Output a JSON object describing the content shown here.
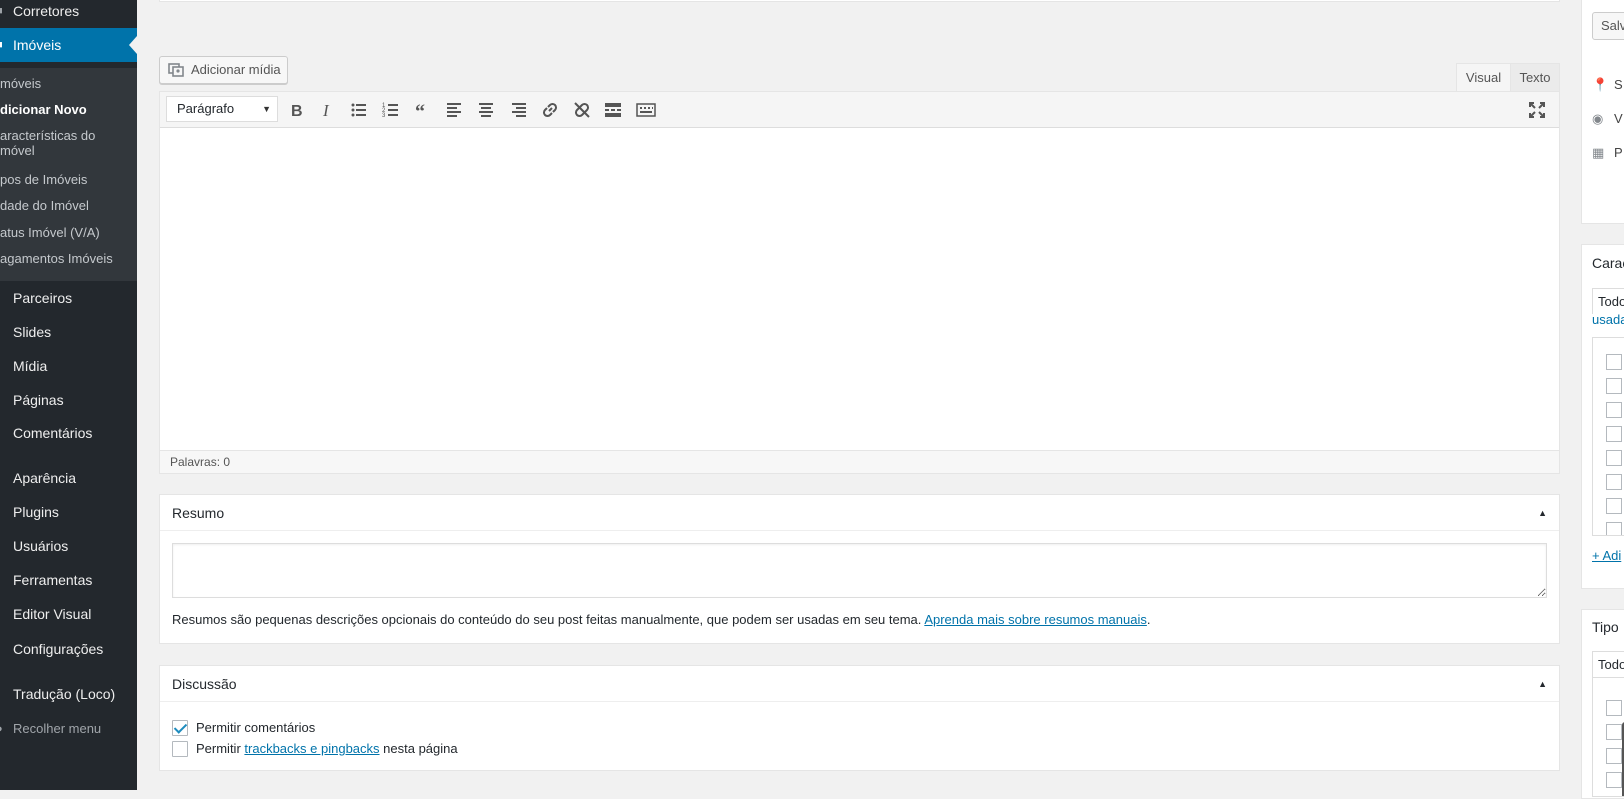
{
  "sidebar": {
    "items_top": [
      {
        "label": "Corretores",
        "icon": "users-icon"
      },
      {
        "label": "Imóveis",
        "icon": "building-icon"
      }
    ],
    "submenu": [
      "móveis",
      "dicionar Novo",
      "aracterísticas do móvel",
      "pos de Imóveis",
      "dade do Imóvel",
      "atus Imóvel (V/A)",
      "agamentos Imóveis"
    ],
    "items_bottom": [
      "Parceiros",
      "Slides",
      "Mídia",
      "Páginas",
      "Comentários",
      "Aparência",
      "Plugins",
      "Usuários",
      "Ferramentas",
      "Editor Visual",
      "Configurações",
      "Tradução (Loco)"
    ],
    "collapse_label": "Recolher menu"
  },
  "editor": {
    "add_media": "Adicionar mídia",
    "tabs": [
      "Visual",
      "Texto"
    ],
    "format_select": "Parágrafo",
    "toolbar_icons": [
      "bold-icon",
      "italic-icon",
      "bullet-list-icon",
      "numbered-list-icon",
      "blockquote-icon",
      "align-left-icon",
      "align-center-icon",
      "align-right-icon",
      "link-icon",
      "unlink-icon",
      "read-more-icon",
      "toolbar-toggle-icon",
      "fullscreen-icon"
    ],
    "word_count": "Palavras: 0"
  },
  "excerpt_box": {
    "title": "Resumo",
    "help_text": "Resumos são pequenas descrições opcionais do conteúdo do seu post feitas manualmente, que podem ser usadas em seu tema.",
    "help_link": "Aprenda mais sobre resumos manuais",
    "help_end": "."
  },
  "discussion_box": {
    "title": "Discussão",
    "allow_comments": "Permitir comentários",
    "allow_comments_checked": true,
    "allow_pings_prefix": "Permitir",
    "allow_pings_link": "trackbacks e pingbacks",
    "allow_pings_suffix": "nesta página",
    "allow_pings_checked": false
  },
  "right_panel": {
    "save_button": "Salv",
    "meta_rows": [
      {
        "icon": "pin-icon",
        "text": "S"
      },
      {
        "icon": "eye-icon",
        "text": "V"
      },
      {
        "icon": "calendar-icon",
        "text": "P"
      }
    ],
    "box1_title": "Carac",
    "box1_tab": "Todo",
    "box1_tab2": "usada",
    "box1_add": "+ Adi",
    "box2_title": "Tipo",
    "box2_tab": "Todo"
  },
  "colors": {
    "sidebar_bg": "#23282d",
    "submenu_bg": "#32373c",
    "accent": "#0073aa",
    "page_bg": "#f1f1f1"
  }
}
